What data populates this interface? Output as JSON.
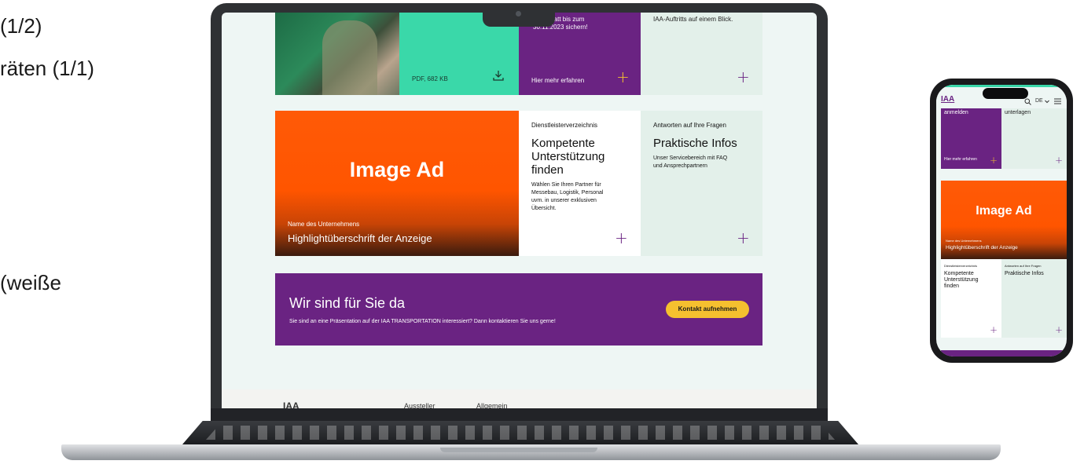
{
  "slide_text": {
    "line1": "(1/2)",
    "line2": "räten (1/1)",
    "line3": "(weiße"
  },
  "laptop": {
    "download_tile": {
      "label": "PDF, 682 KB",
      "icon": "download-icon"
    },
    "promo_tile": {
      "text_line1": "errabatt bis zum",
      "text_line2": "30.11.2023 sichern!",
      "cta": "Hier mehr erfahren"
    },
    "mint_tile": {
      "text": "IAA-Auftritts auf einem Blick."
    },
    "image_ad": {
      "title": "Image Ad",
      "company": "Name des Unternehmens",
      "headline": "Highlightüberschrift der Anzeige"
    },
    "service_tile": {
      "kicker": "Dienstleisterverzeichnis",
      "title_line1": "Kompetente",
      "title_line2": "Unterstützung",
      "title_line3": "finden",
      "body_line1": "Wählen Sie Ihren Partner für",
      "body_line2": "Messebau, Logistik, Personal",
      "body_line3": "uvm. in unserer exklusiven",
      "body_line4": "Übersicht."
    },
    "faq_tile": {
      "kicker": "Antworten auf Ihre Fragen",
      "title": "Praktische Infos",
      "body_line1": "Unser Servicebereich mit FAQ",
      "body_line2": "und Ansprechpartnern"
    },
    "contact_banner": {
      "title": "Wir sind für Sie da",
      "text": "Sie sind an eine Präsentation auf der IAA TRANSPORTATION interessiert? Dann kontaktieren Sie uns gerne!",
      "button": "Kontakt aufnehmen"
    },
    "footer": {
      "logo": "IAA",
      "col1": "Aussteller",
      "col2": "Allgemein"
    },
    "plus_symbol": "+"
  },
  "phone": {
    "logo": "IAA",
    "lang": "DE",
    "tile_left_text": "anmelden",
    "tile_right_text": "unterlagen",
    "promo_cta": "Hier mehr erfahren",
    "image_ad": {
      "title": "Image Ad",
      "company": "Name des Unternehmens",
      "headline": "Highlightüberschrift der Anzeige"
    },
    "service_tile": {
      "kicker": "Dienstleisterverzeichnis",
      "title_line1": "Kompetente",
      "title_line2": "Unterstützung",
      "title_line3": "finden"
    },
    "faq_tile": {
      "kicker": "Antworten auf Ihre Fragen",
      "title": "Praktische Infos"
    }
  },
  "colors": {
    "purple": "#6a2382",
    "mint": "#3ad8a9",
    "orange": "#ff5500",
    "yellow": "#f5c02f",
    "light_green": "#e3f0ea"
  }
}
